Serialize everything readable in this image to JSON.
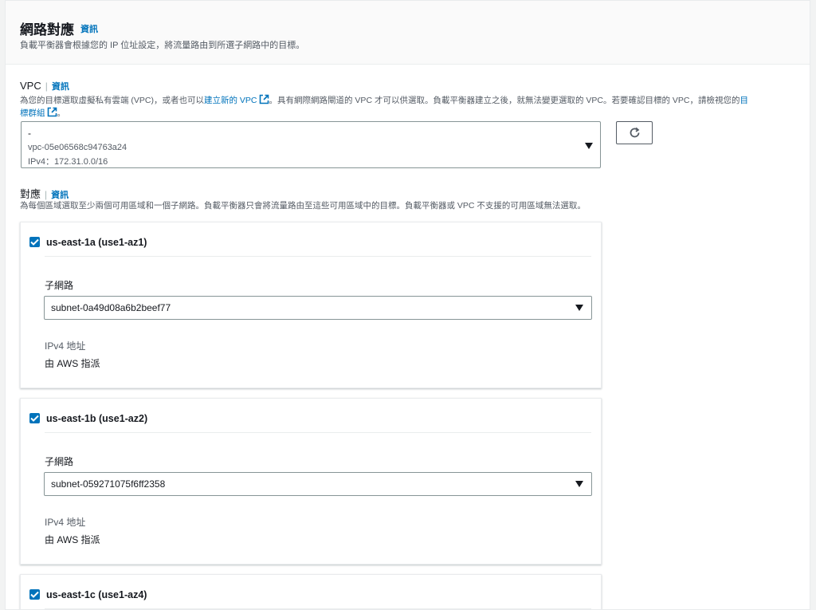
{
  "section": {
    "title": "網路對應",
    "info": "資訊",
    "subtitle": "負載平衡器會根據您的 IP 位址設定，將流量路由到所選子網路中的目標。"
  },
  "vpc": {
    "label": "VPC",
    "info": "資訊",
    "desc_part1": "為您的目標選取虛擬私有雲端 (VPC)，或者也可以",
    "desc_link1": "建立新的 VPC",
    "desc_part2": "。具有網際網路閘道的 VPC 才可以供選取。負載平衡器建立之後，就無法變更選取的 VPC。若要確認目標的 VPC，請檢視您的",
    "desc_link2a": "目",
    "desc_link2b": "標群組",
    "desc_end": "。",
    "selected": {
      "name": "-",
      "id": "vpc-05e06568c94763a24",
      "cidr": "IPv4：172.31.0.0/16"
    },
    "refresh_icon": "refresh-icon"
  },
  "mappings": {
    "label": "對應",
    "info": "資訊",
    "desc": "為每個區域選取至少兩個可用區域和一個子網路。負載平衡器只會將流量路由至這些可用區域中的目標。負載平衡器或 VPC 不支援的可用區域無法選取。"
  },
  "azs": [
    {
      "name": "us-east-1a (use1-az1)",
      "checked": true,
      "subnet_label": "子網路",
      "subnet": "subnet-0a49d08a6b2beef77",
      "ipv4_label": "IPv4 地址",
      "ipv4_value": "由 AWS 指派"
    },
    {
      "name": "us-east-1b (use1-az2)",
      "checked": true,
      "subnet_label": "子網路",
      "subnet": "subnet-059271075f6ff2358",
      "ipv4_label": "IPv4 地址",
      "ipv4_value": "由 AWS 指派"
    },
    {
      "name": "us-east-1c (use1-az4)",
      "checked": true
    }
  ],
  "colors": {
    "link": "#0073bb",
    "checkbox": "#0073bb",
    "header_bg": "#fafafa"
  }
}
